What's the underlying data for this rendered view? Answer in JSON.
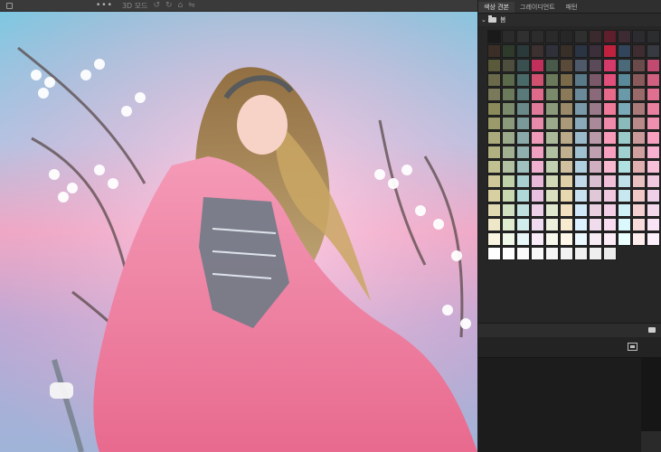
{
  "toolbar": {
    "more_label": "•••",
    "mode_label": "3D 모드",
    "icons": [
      "panel-toggle-icon",
      "more-icon",
      "rotate-icon",
      "redo-icon",
      "home-icon",
      "flip-icon"
    ]
  },
  "panel": {
    "tabs": [
      {
        "label": "색상 견본",
        "active": true
      },
      {
        "label": "그레이디언트",
        "active": false
      },
      {
        "label": "패턴",
        "active": false
      }
    ],
    "folder": {
      "name": "봄",
      "expanded": true
    },
    "swatch_rows": [
      [
        "#1a1a1a",
        "#2b2b2b",
        "#303030",
        "#2c2c2c",
        "#2a2a2a",
        "#272727",
        "#2f2f2f",
        "#3a2a2e",
        "#5e1e2c",
        "#3d2b33",
        "#2c2c30",
        "#2b2d2f",
        "#31393d"
      ],
      [
        "#3a2e26",
        "#2e3a2a",
        "#2a3a3a",
        "#3c3030",
        "#30303a",
        "#383028",
        "#2a3442",
        "#3a2f3a",
        "#c0213f",
        "#33455a",
        "#3e2c30",
        "#373a40",
        "#3a3032"
      ],
      [
        "#5a5a3a",
        "#4e4e3e",
        "#3a5050",
        "#c0305a",
        "#4a5a4a",
        "#5a4a3a",
        "#4e5a6a",
        "#5a4a5a",
        "#d43a6a",
        "#4a6a7a",
        "#6a4a4a",
        "#c04a70",
        "#5a6a5a"
      ],
      [
        "#6a6a4a",
        "#5a6a4a",
        "#4a6a6a",
        "#d05070",
        "#6a7a5a",
        "#7a6a4a",
        "#5a7a8a",
        "#7a5a6a",
        "#e0507a",
        "#5a8a9a",
        "#8a5a5a",
        "#d06080",
        "#6a7a6a"
      ],
      [
        "#7a7a5a",
        "#6a7a5a",
        "#5a7a7a",
        "#e06a8a",
        "#7a8a6a",
        "#8a7a5a",
        "#6a8a9a",
        "#8a6a7a",
        "#e86a8a",
        "#6a9aaa",
        "#9a6a6a",
        "#e07090",
        "#7a8a7a"
      ],
      [
        "#8a8a5a",
        "#7a8a6a",
        "#6a8a8a",
        "#e07a9a",
        "#8a9a7a",
        "#9a8a6a",
        "#7a9aaa",
        "#9a7a8a",
        "#f07a9a",
        "#7aaaba",
        "#aa7a7a",
        "#e880a0",
        "#8a9a8a"
      ],
      [
        "#9a9a6a",
        "#8a9a7a",
        "#7a9a9a",
        "#e88aaa",
        "#9aaa8a",
        "#aa9a7a",
        "#8aaaba",
        "#aa8a9a",
        "#f08aaa",
        "#8ababa",
        "#ba8a8a",
        "#f090b0",
        "#9aaa9a"
      ],
      [
        "#aaaa7a",
        "#9aaa8a",
        "#8aaaaa",
        "#f09aba",
        "#aaba9a",
        "#baaa8a",
        "#9abaca",
        "#ba9aaa",
        "#f89aba",
        "#9acaca",
        "#ca9a9a",
        "#f8a0c0",
        "#aabaaa"
      ],
      [
        "#b0b080",
        "#a0b090",
        "#90b0b0",
        "#f0a0c0",
        "#b0c0a0",
        "#c0b090",
        "#a0c0d0",
        "#c0a0b0",
        "#f8a0c0",
        "#a0d0d0",
        "#d0a0a0",
        "#f8b0d0",
        "#b0c0b0"
      ],
      [
        "#c0c090",
        "#b0c0a0",
        "#a0c0c0",
        "#f0b0d0",
        "#c0d0b0",
        "#d0c0a0",
        "#b0d0e0",
        "#d0b0c0",
        "#f8b8d0",
        "#b0e0e0",
        "#e0b0b0",
        "#f8c0d8",
        "#c0d0c0"
      ],
      [
        "#d0c898",
        "#c0d0a8",
        "#a8d0d0",
        "#e8b8d8",
        "#d0d8b8",
        "#e0d0a8",
        "#c0d8e8",
        "#d8c0d0",
        "#f0c0d8",
        "#c0e0e8",
        "#e8c0c0",
        "#f0c8e0",
        "#d0d8d0"
      ],
      [
        "#d8d0a0",
        "#c8d8b0",
        "#b0d8d8",
        "#e8c0e0",
        "#d8e0c0",
        "#e8d8b0",
        "#c8e0f0",
        "#e0c8d8",
        "#f0c8e0",
        "#c8e8f0",
        "#f0c8c8",
        "#f0d0e8",
        "#d8e0d8"
      ],
      [
        "#e0d8b0",
        "#d0e0c0",
        "#c0e0e0",
        "#ecd0e8",
        "#e0e8d0",
        "#f0e0c0",
        "#d0e8f8",
        "#e8d0e0",
        "#f4d0e8",
        "#d0f0f8",
        "#f4d0d0",
        "#f4d8ec",
        "#e0e8e0"
      ],
      [
        "#eee8c8",
        "#e0ecd0",
        "#d0ecec",
        "#f0dcf0",
        "#ecf0dc",
        "#f8ecd0",
        "#dcf0ff",
        "#f0dcec",
        "#f8dcf0",
        "#dcf8ff",
        "#f8dcdc",
        "#f8e4f4",
        "#ecf0ec"
      ],
      [
        "#f8f4e0",
        "#f0f8e8",
        "#e8f8f8",
        "#f8ecf8",
        "#f8f8ec",
        "#fff8e8",
        "#ecf8ff",
        "#f8ecf4",
        "#fcecf8",
        "#ecffff",
        "#ffecec",
        "#fcf0fa",
        "#f8f8f8"
      ],
      [
        "#ffffff",
        "#fdfdfd",
        "#fafafa",
        "#f8f8f8",
        "#f5f5f5",
        "#f2f2f2",
        "#f0f0f0",
        "#efefef",
        "#ececec",
        "",
        "",
        "",
        ""
      ]
    ],
    "extra_swatches": [
      [
        "#c77d8a",
        "#b7c9a0",
        "#9fd0c2",
        "#e9a0c0",
        "#c9d6b1",
        "#d9b78f",
        "#a7c8e0",
        "#d2a8c6",
        "#f2a7c8",
        "#a8d8e8",
        "#e8a8a8",
        "#f0b4d2",
        "#c8d8c8"
      ]
    ]
  },
  "canvas": {
    "description_hidden": ""
  }
}
